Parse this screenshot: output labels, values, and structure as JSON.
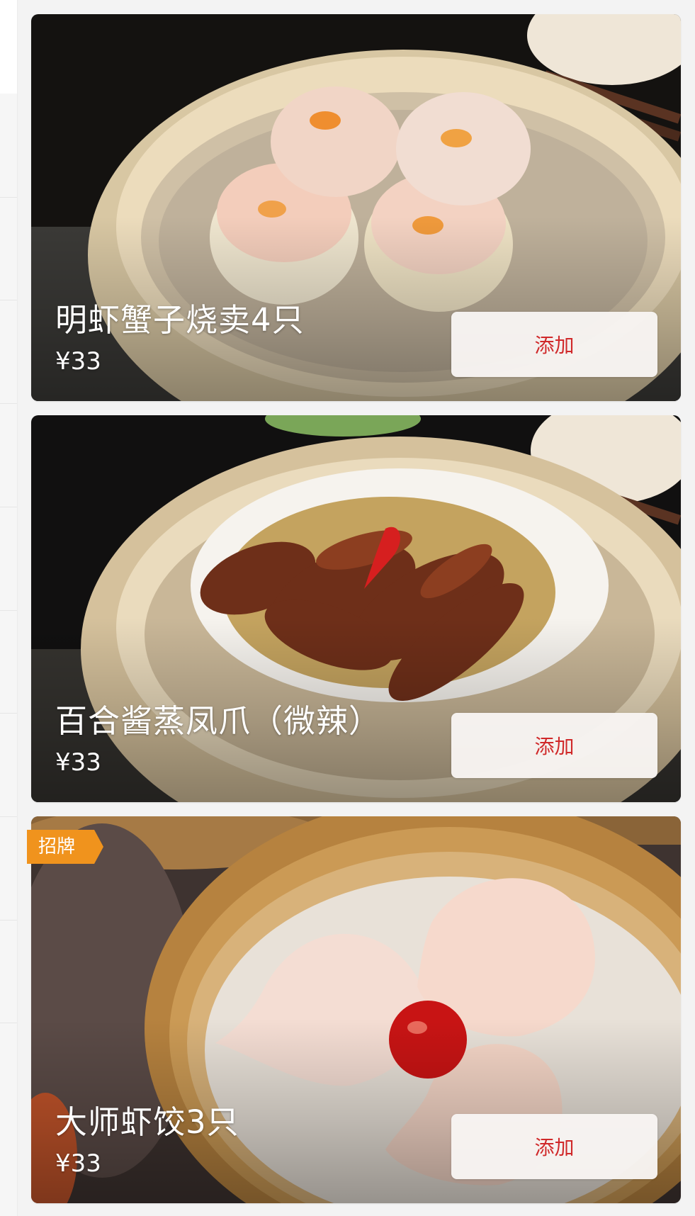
{
  "dishes": [
    {
      "name": "明虾蟹子烧卖4只",
      "price": "¥33",
      "add_label": "添加",
      "badge": null
    },
    {
      "name": "百合酱蒸凤爪（微辣）",
      "price": "¥33",
      "add_label": "添加",
      "badge": null
    },
    {
      "name": "大师虾饺3只",
      "price": "¥33",
      "add_label": "添加",
      "badge": "招牌"
    }
  ],
  "colors": {
    "add_text": "#d0292a",
    "badge_bg": "#f0931d",
    "page_bg": "#f3f3f3"
  }
}
